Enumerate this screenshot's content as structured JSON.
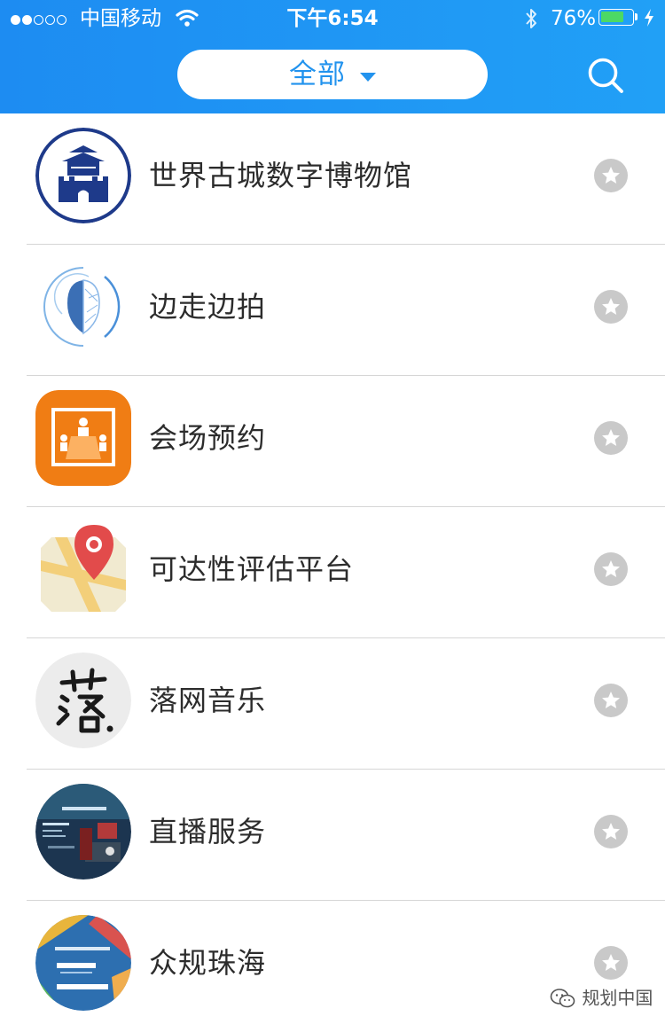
{
  "status_bar": {
    "carrier": "中国移动",
    "time": "下午6:54",
    "battery_percent": "76%",
    "battery_level": 0.76,
    "signal_bars_filled": 2,
    "signal_bars_total": 5
  },
  "header": {
    "filter_label": "全部",
    "search_icon": "search-icon",
    "accent_color": "#1d8cf2"
  },
  "apps": [
    {
      "name": "世界古城数字博物馆",
      "icon": "ancient-gate-tower-icon"
    },
    {
      "name": "边走边拍",
      "icon": "face-scan-icon"
    },
    {
      "name": "会场预约",
      "icon": "meeting-room-icon"
    },
    {
      "name": "可达性评估平台",
      "icon": "map-pin-icon"
    },
    {
      "name": "落网音乐",
      "icon": "calligraphy-luo-icon"
    },
    {
      "name": "直播服务",
      "icon": "live-broadcast-thumbnail-icon"
    },
    {
      "name": "众规珠海",
      "icon": "data-reporting-thumbnail-icon"
    }
  ],
  "favorite_icon": "star-icon",
  "watermark": {
    "text": "规划中国",
    "icon": "wechat-icon"
  }
}
